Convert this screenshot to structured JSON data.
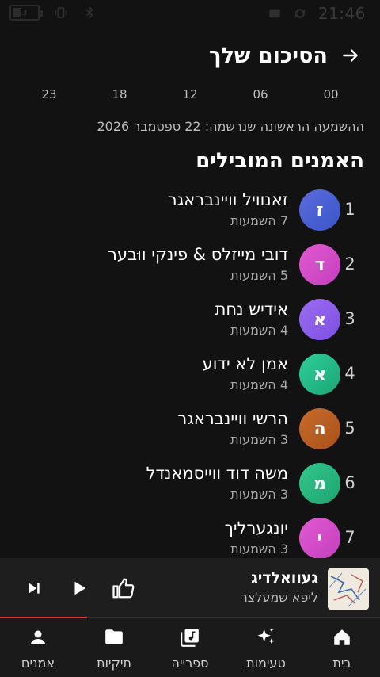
{
  "status_bar": {
    "battery_level": "3",
    "time": "21:46",
    "icons": [
      "battery-icon",
      "vibrate-icon",
      "bluetooth-icon",
      "sim-icon",
      "sync-icon"
    ]
  },
  "header": {
    "title": "הסיכום שלך",
    "back_icon": "arrow-icon"
  },
  "hours_axis": [
    "00",
    "06",
    "12",
    "18",
    "23"
  ],
  "first_listen": "ההשמעה הראשונה שנרשמה: 22 ספטמבר 2026",
  "top_artists": {
    "title": "האמנים המובילים",
    "items": [
      {
        "rank": "1",
        "initial": "ז",
        "name": "זאנוויל וויינבראגר",
        "plays": "7 השמעות",
        "color_from": "#5c6bdc",
        "color_to": "#3a56c9"
      },
      {
        "rank": "2",
        "initial": "ד",
        "name": "דובי מייזלס & פינקי ווּבער",
        "plays": "5 השמעות",
        "color_from": "#e15ad0",
        "color_to": "#c43fc0"
      },
      {
        "rank": "3",
        "initial": "א",
        "name": "אידיש נחת",
        "plays": "4 השמעות",
        "color_from": "#9b6cf0",
        "color_to": "#7e4fe2"
      },
      {
        "rank": "4",
        "initial": "א",
        "name": "אמן לא ידוע",
        "plays": "4 השמעות",
        "color_from": "#2fcf9a",
        "color_to": "#1aa676"
      },
      {
        "rank": "5",
        "initial": "ה",
        "name": "הרשי וויינבראגר",
        "plays": "3 השמעות",
        "color_from": "#c96a2a",
        "color_to": "#a85219"
      },
      {
        "rank": "6",
        "initial": "מ",
        "name": "משה דוד ווייסמאנדל",
        "plays": "3 השמעות",
        "color_from": "#32c98c",
        "color_to": "#1fa270"
      },
      {
        "rank": "7",
        "initial": "י",
        "name": "יונגערליך",
        "plays": "3 השמעות",
        "color_from": "#e15ad0",
        "color_to": "#c43fc0"
      }
    ]
  },
  "mini_player": {
    "title": "געוואלדיג",
    "artist": "ליפא שמעלצר",
    "progress": 0.23,
    "icons": [
      "thumbs-up-icon",
      "play-icon",
      "skip-next-icon"
    ]
  },
  "bottom_nav": [
    {
      "label": "בית",
      "icon": "home-icon"
    },
    {
      "label": "טעימות",
      "icon": "sparkle-icon"
    },
    {
      "label": "ספרייה",
      "icon": "library-icon"
    },
    {
      "label": "תיקיות",
      "icon": "folder-icon"
    },
    {
      "label": "אמנים",
      "icon": "person-icon"
    }
  ]
}
